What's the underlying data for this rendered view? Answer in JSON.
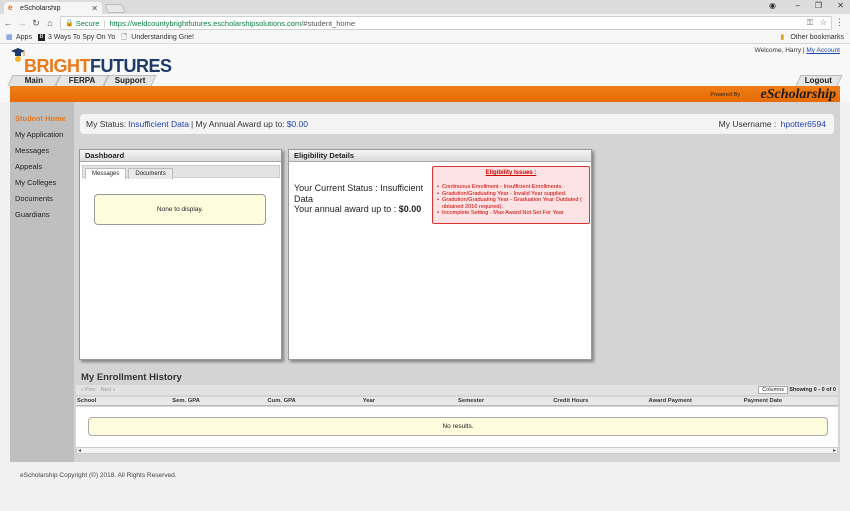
{
  "browser": {
    "tab_title": "eScholarship",
    "secure_label": "Secure",
    "url_host": "https://weldcountybrightfutures.escholarshipsolutions.com",
    "url_path": "/#student_home",
    "bookmarks": {
      "apps": "Apps",
      "item1": "3 Ways To Spy On Yo",
      "item2": "Understanding Grie!",
      "other": "Other bookmarks"
    }
  },
  "header": {
    "logo_bright": "BRIGHT",
    "logo_futures": "FUTURES",
    "welcome": "Welcome, Harry |",
    "my_account": "My Account",
    "nav": [
      "Main",
      "FERPA",
      "Support"
    ],
    "logout": "Logout",
    "powered_by": "Powered By",
    "brand": "eScholarship"
  },
  "sidebar": {
    "items": [
      "Student Home",
      "My Application",
      "Messages",
      "Appeals",
      "My Colleges",
      "Documents",
      "Guardians"
    ]
  },
  "status": {
    "my_status_label": "My Status:",
    "my_status_value": "Insufficient Data",
    "award_label": "| My Annual Award up to:",
    "award_value": "$0.00",
    "username_label": "My Username :",
    "username_value": "hpotter6594"
  },
  "dashboard": {
    "title": "Dashboard",
    "tabs": [
      "Messages",
      "Documents"
    ],
    "empty_text": "None to display."
  },
  "eligibility": {
    "title": "Eligibility Details",
    "current_status": "Your Current Status : Insufficient Data",
    "annual_award_label": "Your annual award up to :",
    "annual_award_value": "$0.00",
    "issues_title": "Eligibility Issues :",
    "issues": [
      "Continuous Enrollment - Insufficient Enrollments.",
      "Gradution/Graduating Year - Invalid Year supplied.",
      "Gradution/Graduating Year - Graduation Year Outdated ( obtained 2016 required).",
      "Incomplete Setting - Max Award Not Set For Year"
    ]
  },
  "enrollment": {
    "title": "My Enrollment History",
    "prev": "« Prev",
    "next": "Next »",
    "columns_button": "Columns",
    "showing": "Showing 0 - 0 of 0",
    "headers": [
      "School",
      "Sem. GPA",
      "Cum. GPA",
      "Year",
      "Semester",
      "Credit Hours",
      "Award Payment",
      "Payment Date"
    ],
    "empty_text": "No results."
  },
  "footer": {
    "copyright": "eScholarship Copyright (©) 2018. All Rights Reserved."
  }
}
